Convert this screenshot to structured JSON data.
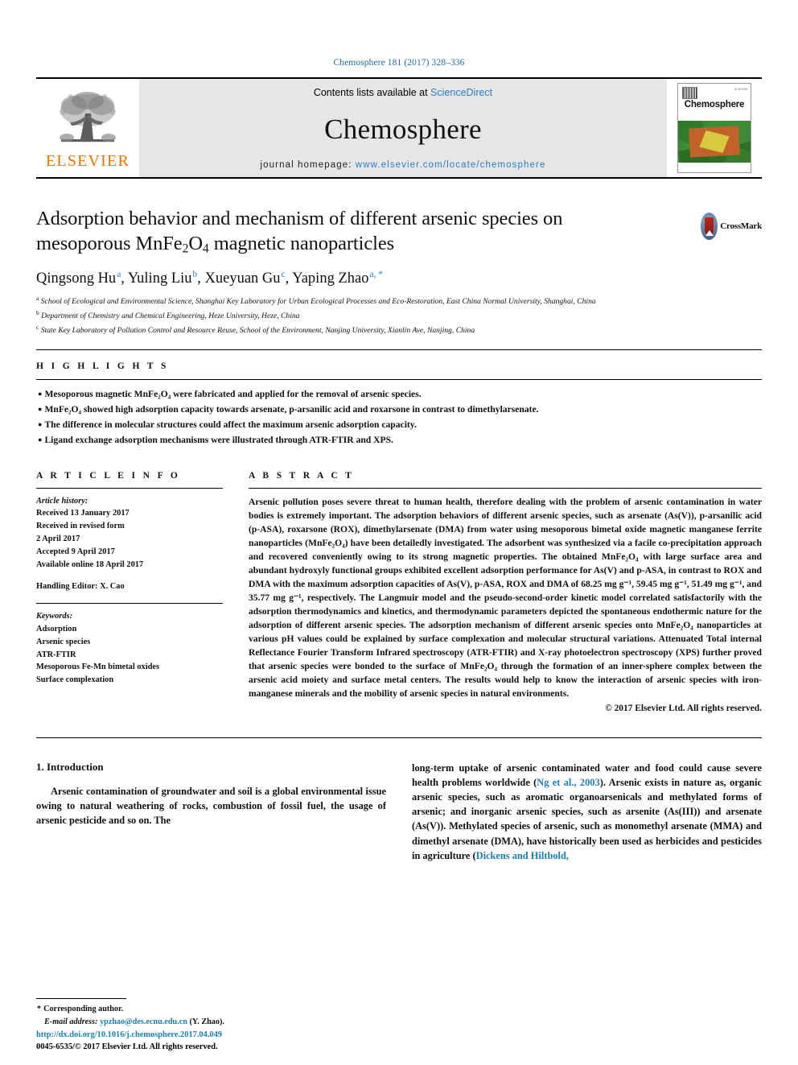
{
  "running_head": "Chemosphere 181 (2017) 328–336",
  "masthead": {
    "publisher_logo_text": "ELSEVIER",
    "contents_prefix": "Contents lists available at ",
    "contents_link": "ScienceDirect",
    "journal_name": "Chemosphere",
    "homepage_prefix": "journal homepage: ",
    "homepage_url": "www.elsevier.com/locate/chemosphere",
    "cover_title": "Chemosphere",
    "cover_topright": "ELSEVIER"
  },
  "article": {
    "title_line1": "Adsorption behavior and mechanism of different arsenic species on",
    "title_line2_pre": "mesoporous MnFe",
    "title_sub1": "2",
    "title_line2_mid": "O",
    "title_sub2": "4",
    "title_line2_post": " magnetic nanoparticles",
    "crossmark_label": "CrossMark",
    "authors": [
      {
        "name": "Qingsong Hu",
        "marks": "a",
        "sep": ", "
      },
      {
        "name": "Yuling Liu",
        "marks": "b",
        "sep": ", "
      },
      {
        "name": "Xueyuan Gu",
        "marks": "c",
        "sep": ", "
      },
      {
        "name": "Yaping Zhao",
        "marks": "a, *",
        "sep": ""
      }
    ],
    "affiliations": [
      {
        "mark": "a",
        "text": "School of Ecological and Environmental Science, Shanghai Key Laboratory for Urban Ecological Processes and Eco-Restoration, East China Normal University, Shanghai, China"
      },
      {
        "mark": "b",
        "text": "Department of Chemistry and Chemical Engineering, Heze University, Heze, China"
      },
      {
        "mark": "c",
        "text": "State Key Laboratory of Pollution Control and Resource Reuse, School of the Environment, Nanjing University, Xianlin Ave, Nanjing, China"
      }
    ]
  },
  "highlights": {
    "label": "H I G H L I G H T S",
    "items": [
      "Mesoporous magnetic MnFe₂O₄ were fabricated and applied for the removal of arsenic species.",
      "MnFe₂O₄ showed high adsorption capacity towards arsenate, p-arsanilic acid and roxarsone in contrast to dimethylarsenate.",
      "The difference in molecular structures could affect the maximum arsenic adsorption capacity.",
      "Ligand exchange adsorption mechanisms were illustrated through ATR-FTIR and XPS."
    ]
  },
  "article_info": {
    "label": "A R T I C L E   I N F O",
    "history_head": "Article history:",
    "history_lines": [
      "Received 13 January 2017",
      "Received in revised form",
      "2 April 2017",
      "Accepted 9 April 2017",
      "Available online 18 April 2017"
    ],
    "handling_editor": "Handling Editor: X. Cao",
    "keywords_head": "Keywords:",
    "keywords": [
      "Adsorption",
      "Arsenic species",
      "ATR-FTIR",
      "Mesoporous Fe-Mn bimetal oxides",
      "Surface complexation"
    ]
  },
  "abstract": {
    "label": "A B S T R A C T",
    "text": "Arsenic pollution poses severe threat to human health, therefore dealing with the problem of arsenic contamination in water bodies is extremely important. The adsorption behaviors of different arsenic species, such as arsenate (As(V)), p-arsanilic acid (p-ASA), roxarsone (ROX), dimethylarsenate (DMA) from water using mesoporous bimetal oxide magnetic manganese ferrite nanoparticles (MnFe₂O₄) have been detailedly investigated. The adsorbent was synthesized via a facile co-precipitation approach and recovered conveniently owing to its strong magnetic properties. The obtained MnFe₂O₄ with large surface area and abundant hydroxyly functional groups exhibited excellent adsorption performance for As(V) and p-ASA, in contrast to ROX and DMA with the maximum adsorption capacities of As(V), p-ASA, ROX and DMA of 68.25 mg g⁻¹, 59.45 mg g⁻¹, 51.49 mg g⁻¹, and 35.77 mg g⁻¹, respectively. The Langmuir model and the pseudo-second-order kinetic model correlated satisfactorily with the adsorption thermodynamics and kinetics, and thermodynamic parameters depicted the spontaneous endothermic nature for the adsorption of different arsenic species. The adsorption mechanism of different arsenic species onto MnFe₂O₄ nanoparticles at various pH values could be explained by surface complexation and molecular structural variations. Attenuated Total internal Reflectance Fourier Transform Infrared spectroscopy (ATR-FTIR) and X-ray photoelectron spectroscopy (XPS) further proved that arsenic species were bonded to the surface of MnFe₂O₄ through the formation of an inner-sphere complex between the arsenic acid moiety and surface metal centers. The results would help to know the interaction of arsenic species with iron-manganese minerals and the mobility of arsenic species in natural environments.",
    "copyright": "© 2017 Elsevier Ltd. All rights reserved."
  },
  "body": {
    "section_number_title": "1. Introduction",
    "left_paragraph": "Arsenic contamination of groundwater and soil is a global environmental issue owing to natural weathering of rocks, combustion of fossil fuel, the usage of arsenic pesticide and so on. The",
    "right_paragraph_1": "long-term uptake of arsenic contaminated water and food could cause severe health problems worldwide (",
    "right_citation_1": "Ng et al., 2003",
    "right_paragraph_2": "). Arsenic exists in nature as, organic arsenic species, such as aromatic organoarsenicals and methylated forms of arsenic; and inorganic arsenic species, such as arsenite (As(III)) and arsenate (As(V)). Methylated species of arsenic, such as monomethyl arsenate (MMA) and dimethyl arsenate (DMA), have historically been used as herbicides and pesticides in agriculture (",
    "right_citation_2": "Dickens and Hiltbold,"
  },
  "footer": {
    "corresponding_author": "Corresponding author.",
    "email_label": "E-mail address: ",
    "email": "ypzhao@des.ecnu.edu.cn",
    "email_suffix": " (Y. Zhao).",
    "doi_url": "http://dx.doi.org/10.1016/j.chemosphere.2017.04.049",
    "issn_line": "0045-6535/© 2017 Elsevier Ltd. All rights reserved."
  },
  "colors": {
    "link_blue": "#1b7fb5",
    "header_blue": "#1b6ca8",
    "elsevier_orange": "#e87500",
    "masthead_grey": "#e6e6e6"
  }
}
